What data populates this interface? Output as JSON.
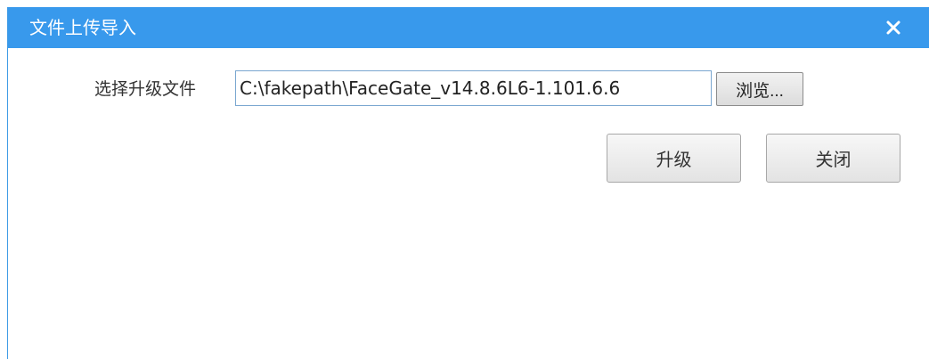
{
  "dialog": {
    "title": "文件上传导入",
    "close_icon": "close-icon"
  },
  "form": {
    "file_label": "选择升级文件",
    "file_path": "C:\\fakepath\\FaceGate_v14.8.6L6-1.101.6.6",
    "browse_label": "浏览..."
  },
  "actions": {
    "upgrade_label": "升级",
    "close_label": "关闭"
  },
  "colors": {
    "titlebar": "#3899ec",
    "title_text": "#ffffff"
  }
}
